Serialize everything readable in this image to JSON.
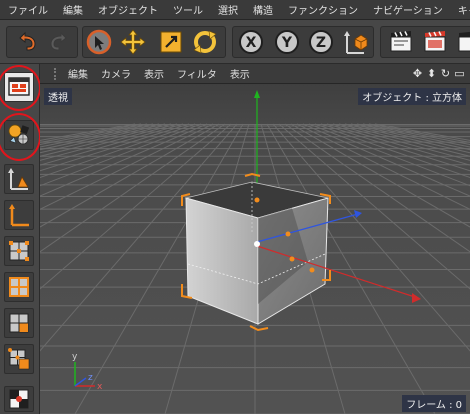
{
  "menubar": {
    "items": [
      "ファイル",
      "編集",
      "オブジェクト",
      "ツール",
      "選択",
      "構造",
      "ファンクション",
      "ナビゲーション",
      "キャ"
    ]
  },
  "toolbar": {
    "groups": [
      {
        "buttons": [
          "undo-icon",
          "redo-icon"
        ]
      },
      {
        "buttons": [
          "live-select-icon",
          "move-icon",
          "scale-icon",
          "rotate-icon"
        ]
      },
      {
        "buttons": [
          "x-axis-lock-icon",
          "y-axis-lock-icon",
          "z-axis-lock-icon",
          "coordinate-system-icon"
        ]
      },
      {
        "buttons": [
          "render-view-icon",
          "render-to-picture-viewer-icon",
          "render-settings-icon"
        ]
      }
    ],
    "axis_letters": {
      "x": "X",
      "y": "Y",
      "z": "Z"
    }
  },
  "viewport_menu": {
    "items": [
      "編集",
      "カメラ",
      "表示",
      "フィルタ",
      "表示"
    ]
  },
  "viewport": {
    "view_name": "透視",
    "object_info": "オブジェクト : 立方体",
    "frame_info": "フレーム : 0",
    "axis_labels": {
      "x": "x",
      "y": "y",
      "z": "z"
    }
  },
  "left_palette": {
    "buttons": [
      "model-mode-icon",
      "texture-mode-icon",
      "object-axis-icon",
      "workplane-icon",
      "points-mode-icon",
      "edges-mode-icon",
      "polygons-mode-icon",
      "uvw-mode-icon",
      "solo-icon"
    ],
    "highlighted": [
      "model-mode-icon",
      "texture-mode-icon"
    ]
  },
  "colors": {
    "menu_bg": "#3a3a3a",
    "toolbar_bg": "#474747",
    "viewport_bg": "#4d4d4d",
    "grid_line": "#6a6a6a",
    "axis_x": "#d12b2b",
    "axis_y": "#1fb51f",
    "axis_z": "#2f55e0",
    "selection_orange": "#f28c1c",
    "highlight_red": "#e1151c"
  }
}
